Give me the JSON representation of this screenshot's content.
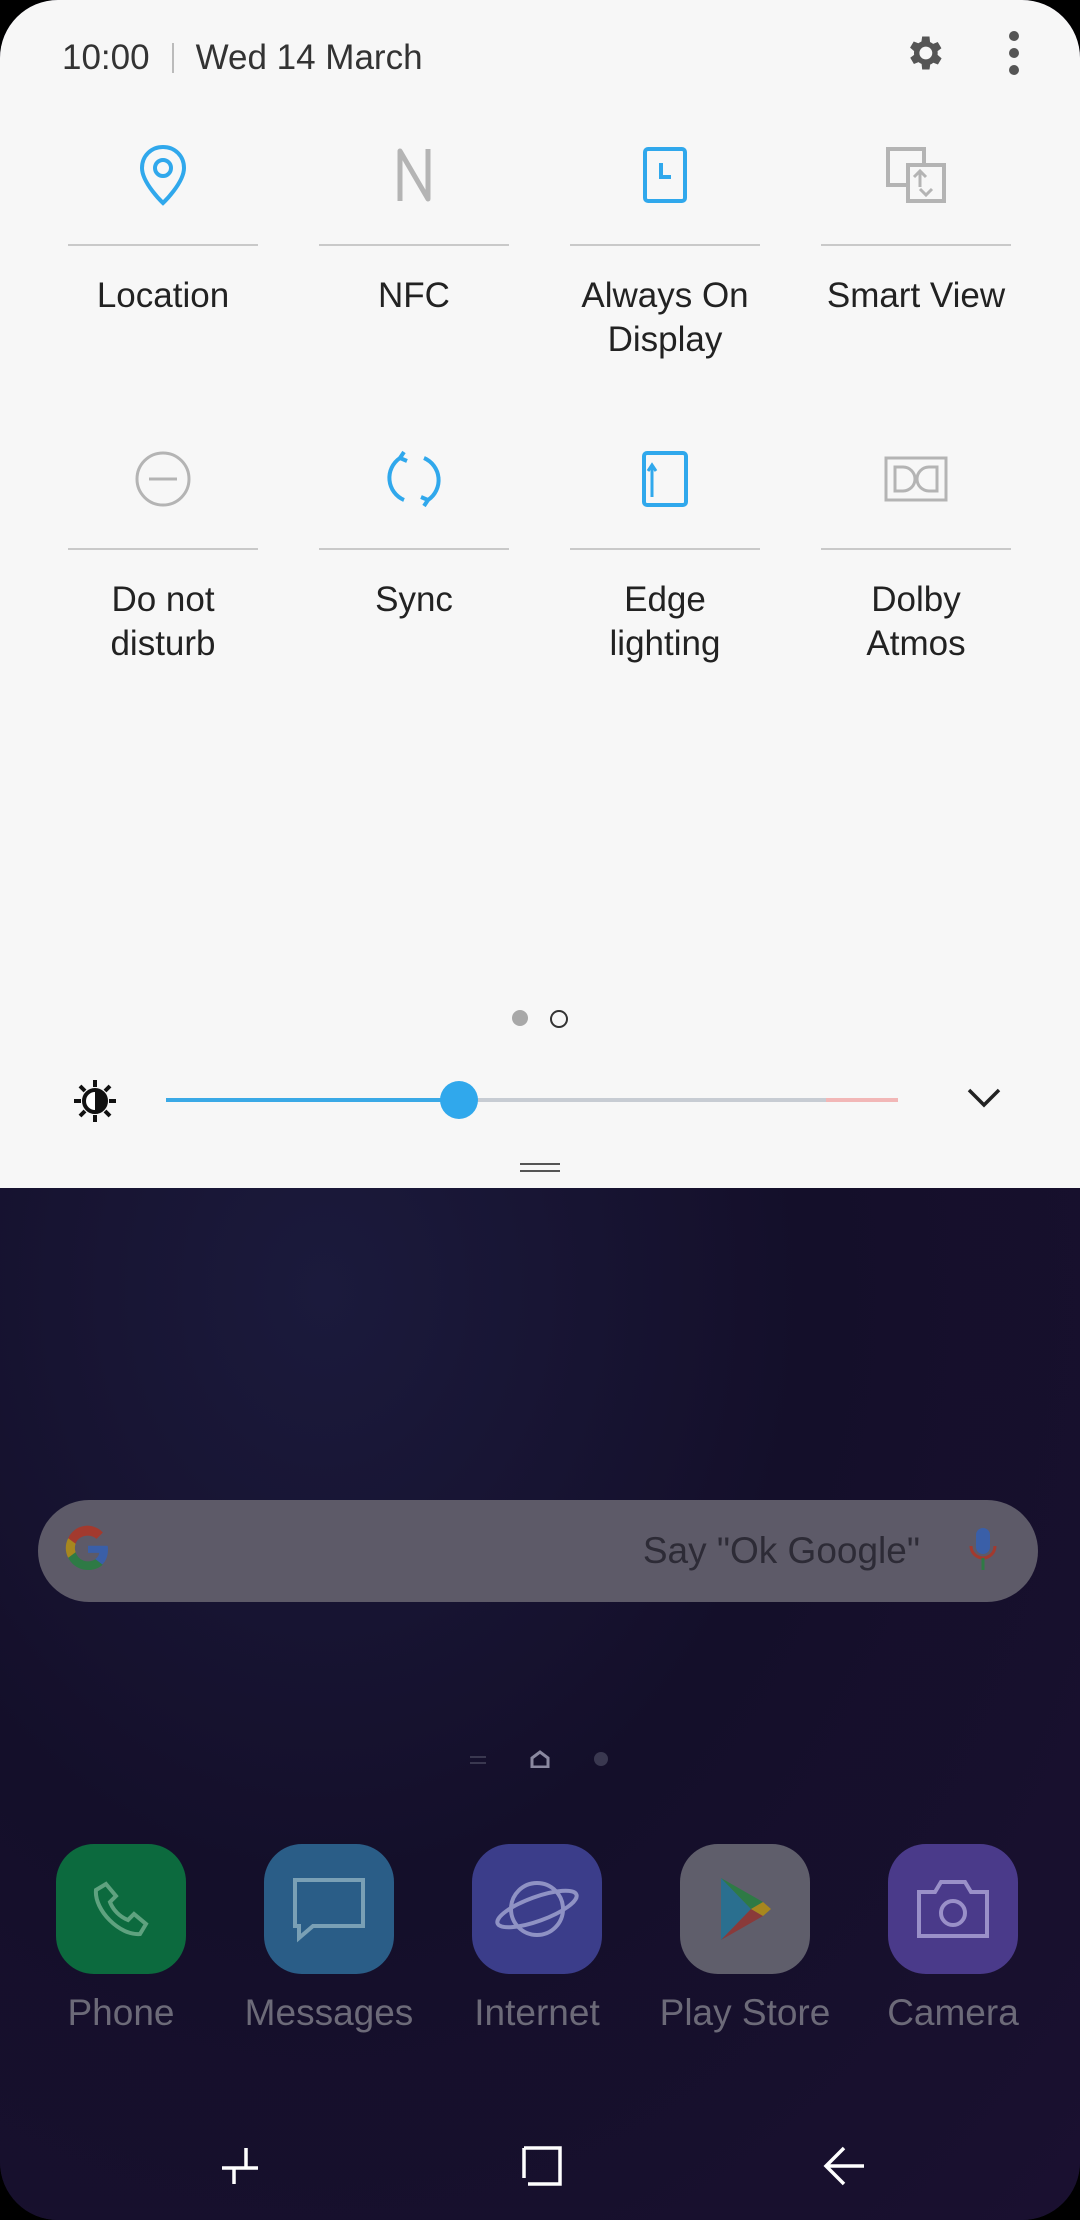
{
  "status": {
    "time": "10:00",
    "date": "Wed 14 March"
  },
  "tiles": [
    {
      "label": "Location",
      "icon": "location-icon",
      "active": true
    },
    {
      "label": "NFC",
      "icon": "nfc-icon",
      "active": false
    },
    {
      "label": "Always On\nDisplay",
      "icon": "always-on-display-icon",
      "active": true
    },
    {
      "label": "Smart View",
      "icon": "smart-view-icon",
      "active": false
    },
    {
      "label": "Do not\ndisturb",
      "icon": "do-not-disturb-icon",
      "active": false
    },
    {
      "label": "Sync",
      "icon": "sync-icon",
      "active": true
    },
    {
      "label": "Edge lighting",
      "icon": "edge-lighting-icon",
      "active": true
    },
    {
      "label": "Dolby Atmos",
      "icon": "dolby-atmos-icon",
      "active": false
    }
  ],
  "brightness": {
    "level": 0.4
  },
  "search": {
    "hint": "Say \"Ok Google\""
  },
  "dock": [
    {
      "label": "Phone",
      "icon": "phone-icon",
      "color": "#0c6a3e"
    },
    {
      "label": "Messages",
      "icon": "messages-icon",
      "color": "#2a5d87"
    },
    {
      "label": "Internet",
      "icon": "internet-icon",
      "color": "#3b3d8a"
    },
    {
      "label": "Play Store",
      "icon": "play-store-icon",
      "color": "#5f5e6b"
    },
    {
      "label": "Camera",
      "icon": "camera-icon",
      "color": "#4a3a8a"
    }
  ],
  "colors": {
    "accent": "#30a8ec",
    "inactive": "#b4b4b4",
    "panel": "#f7f7f7"
  }
}
